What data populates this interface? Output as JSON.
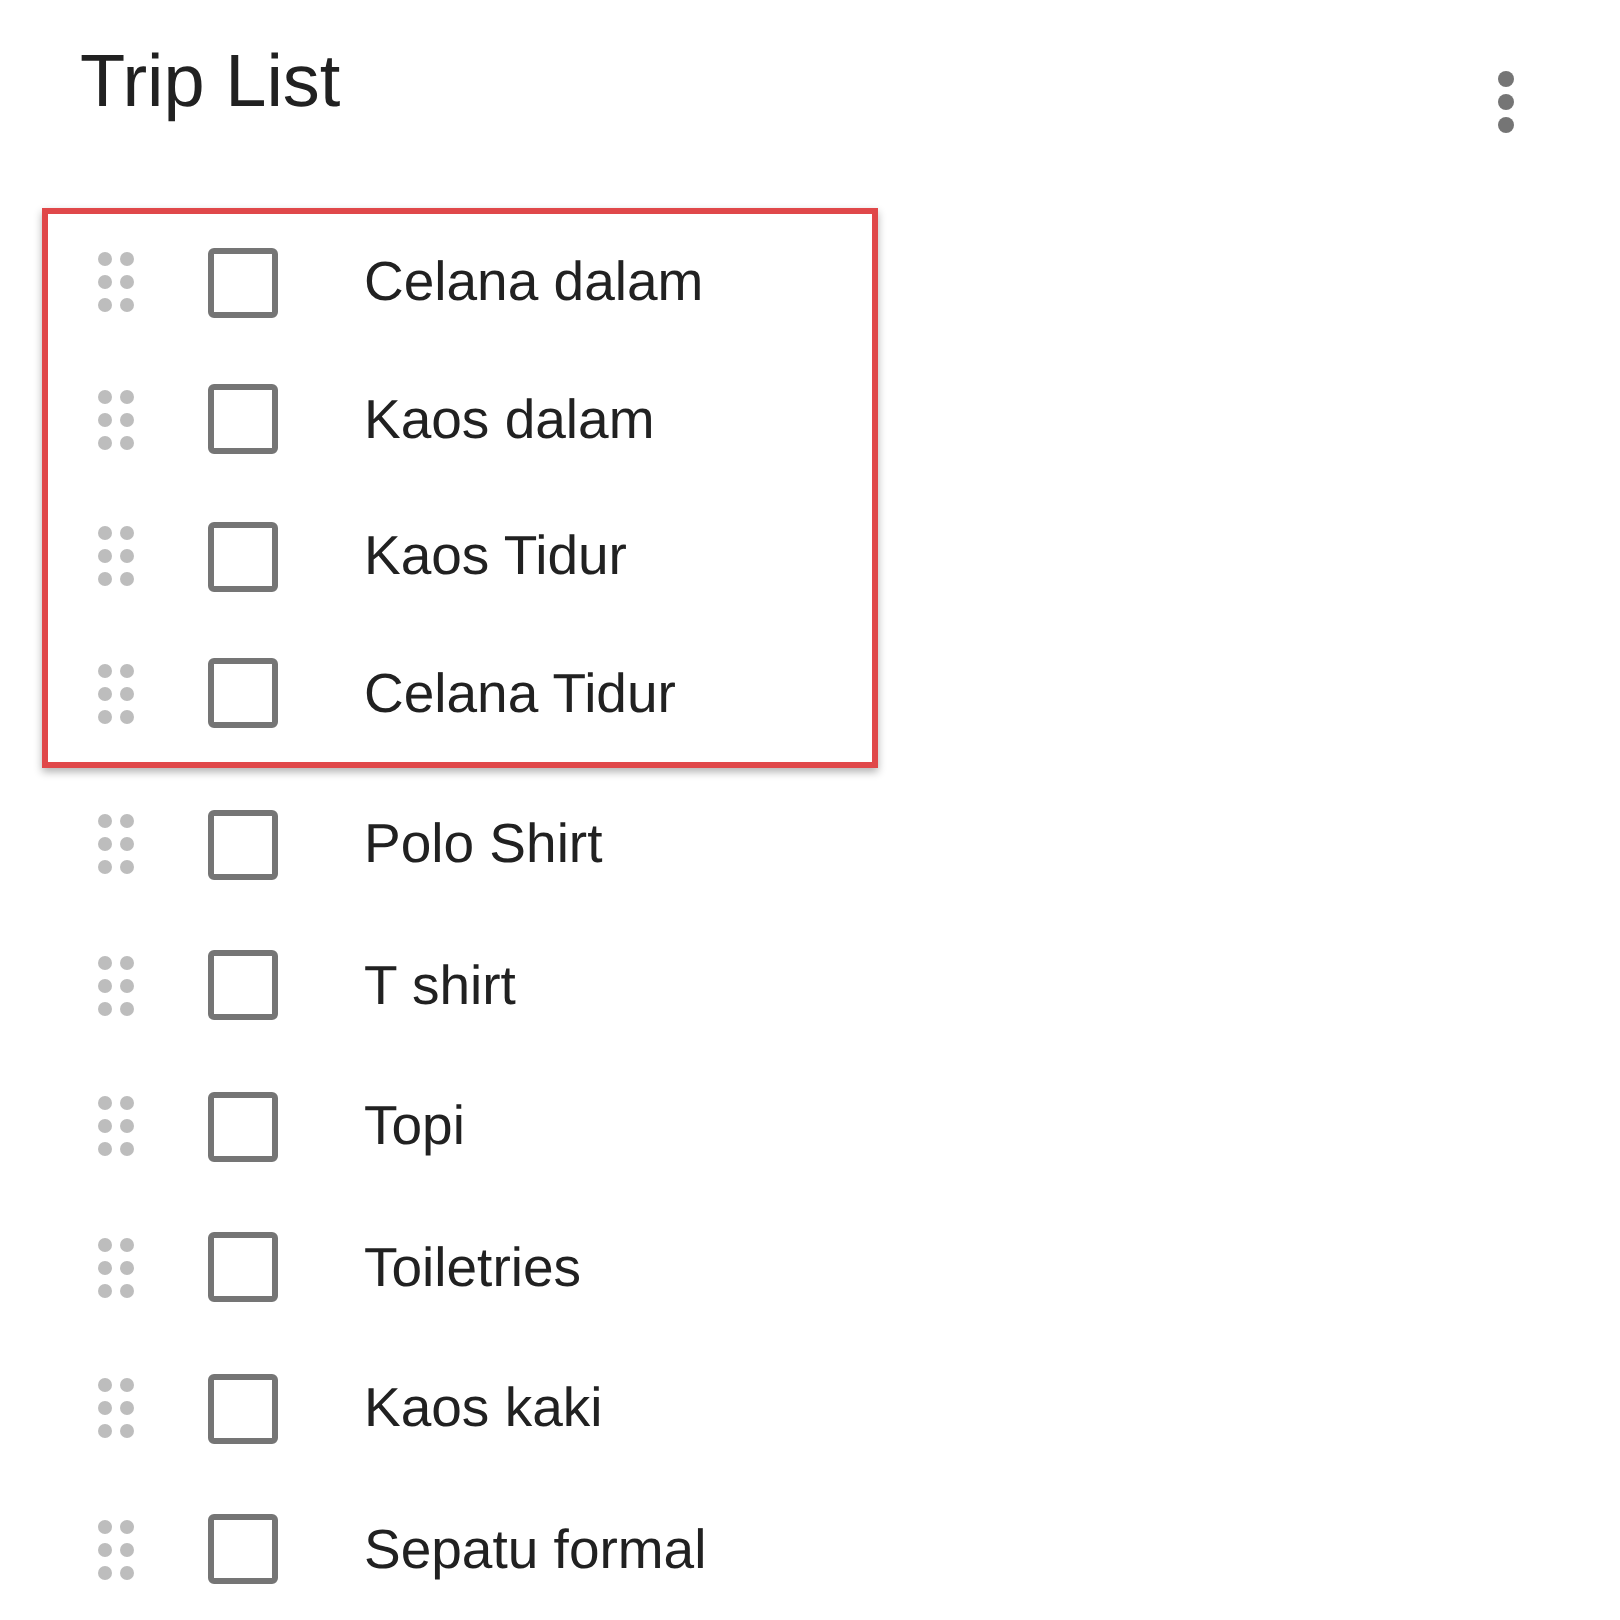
{
  "header": {
    "title": "Trip List"
  },
  "items": [
    {
      "label": "Celana dalam",
      "checked": false,
      "highlighted": true
    },
    {
      "label": "Kaos dalam",
      "checked": false,
      "highlighted": true
    },
    {
      "label": "Kaos Tidur",
      "checked": false,
      "highlighted": true
    },
    {
      "label": "Celana Tidur",
      "checked": false,
      "highlighted": true
    },
    {
      "label": "Polo Shirt",
      "checked": false,
      "highlighted": false
    },
    {
      "label": "T shirt",
      "checked": false,
      "highlighted": false
    },
    {
      "label": "Topi",
      "checked": false,
      "highlighted": false
    },
    {
      "label": "Toiletries",
      "checked": false,
      "highlighted": false
    },
    {
      "label": "Kaos kaki",
      "checked": false,
      "highlighted": false
    },
    {
      "label": "Sepatu formal",
      "checked": false,
      "highlighted": false
    }
  ]
}
